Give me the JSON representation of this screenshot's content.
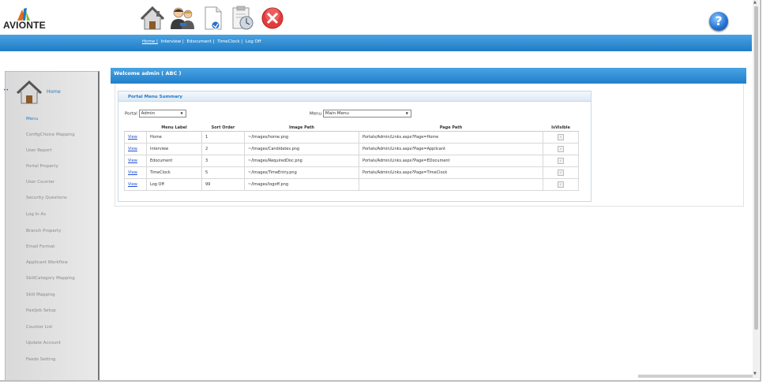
{
  "brand": {
    "logo_text": "AVIONTE"
  },
  "toolbar": {
    "icons": [
      "home-icon",
      "interview-people-icon",
      "document-icon",
      "timeclock-icon",
      "logoff-icon"
    ],
    "help": "?"
  },
  "nav": {
    "links": [
      "Home |",
      "Interview |",
      "Edocument |",
      "TimeClock |",
      "Log Off"
    ],
    "accent": "#1f7bc6"
  },
  "sidebar": {
    "home_label": "Home",
    "items": [
      "Menu",
      "ConfigChoice Mapping",
      "User Report",
      "Portal Property",
      "User Counter",
      "Security Questions",
      "Log In As",
      "Branch Property",
      "Email Format",
      "Applicant Workflow",
      "SkillCategory Mapping",
      "Skill Mapping",
      "PastJob Setup",
      "Counter List",
      "Update Account",
      "Feeds Setting"
    ]
  },
  "main": {
    "welcome": "Welcome admin ( ABC )",
    "panel_title": "Portal Menu Summary",
    "portal_label": "Portal",
    "portal_value": "Admin",
    "menu_label": "Menu",
    "menu_value": "Main Menu"
  },
  "table": {
    "headers": [
      "",
      "Menu Label",
      "Sort Order",
      "Image Path",
      "Page Path",
      "IsVisible"
    ],
    "rows": [
      {
        "link": "View",
        "label": "Home",
        "sort": "1",
        "image": "~/Images/home.png",
        "page": "Portals/Admin/Links.aspx?Page=Home"
      },
      {
        "link": "View",
        "label": "Interview",
        "sort": "2",
        "image": "~/Images/Candidates.png",
        "page": "Portals/Admin/Links.aspx?Page=Applicant"
      },
      {
        "link": "View",
        "label": "Edocument",
        "sort": "3",
        "image": "~/Images/RequiredDoc.png",
        "page": "Portals/Admin/Links.aspx?Page=EDocument"
      },
      {
        "link": "View",
        "label": "TimeClock",
        "sort": "5",
        "image": "~/Images/TimeEntry.png",
        "page": "Portals/Admin/Links.aspx?Page=TimeClock"
      },
      {
        "link": "View",
        "label": "Log Off",
        "sort": "99",
        "image": "~/Images/logoff.png",
        "page": ""
      }
    ],
    "checkbox_mark": "✓"
  }
}
